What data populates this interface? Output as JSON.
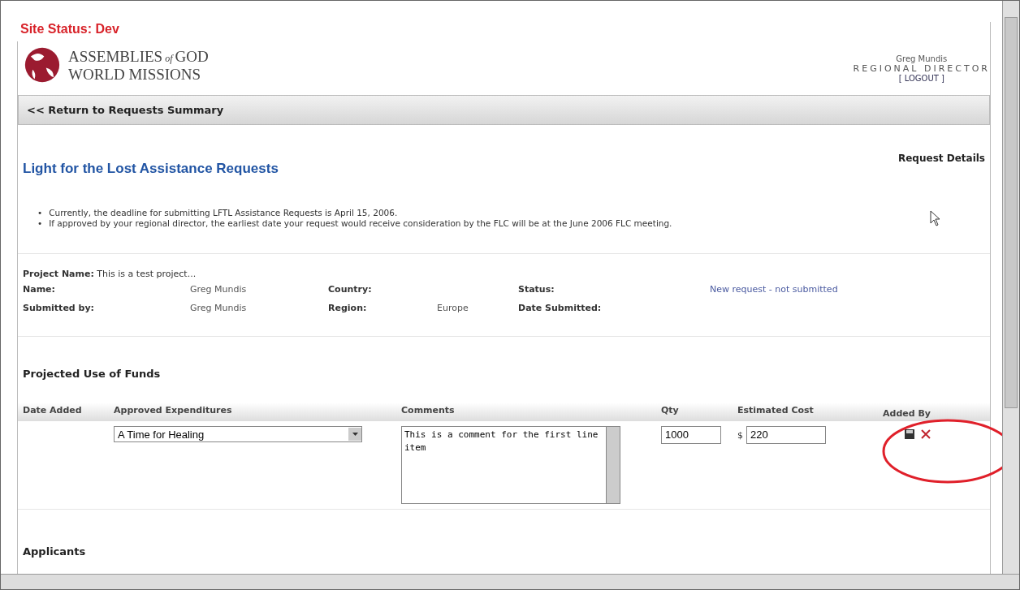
{
  "site_status": "Site Status: Dev",
  "logo": {
    "line1_a": "ASSEMBLIES",
    "line1_of": "of",
    "line1_b": "GOD",
    "line2": "WORLD MISSIONS"
  },
  "user": {
    "name": "Greg Mundis",
    "role": "REGIONAL DIRECTOR",
    "logout": "[ LOGOUT ]"
  },
  "nav": {
    "back_link": "<< Return to Requests Summary"
  },
  "page": {
    "title": "Light for the Lost Assistance Requests",
    "section_label": "Request Details"
  },
  "notes": [
    {
      "bullet": "•",
      "text": "Currently, the deadline for submitting LFTL Assistance Requests is April 15, 2006."
    },
    {
      "bullet": "•",
      "text": "If approved by your regional director, the earliest date your request would receive consideration by the FLC will be at the June 2006 FLC meeting."
    }
  ],
  "project": {
    "label": "Project Name:",
    "value": "This is a test project...",
    "fields": [
      {
        "label": "Name:",
        "value": "Greg Mundis",
        "kind": "plain"
      },
      {
        "label": "Country:"
      },
      {
        "label": "Status:",
        "value": "New request - not submitted",
        "kind": "link"
      },
      {
        "label": "Submitted by:",
        "value": "Greg Mundis",
        "kind": "plain"
      },
      {
        "label": "Region:",
        "value": "Europe",
        "kind": "plain"
      },
      {
        "label": "Date Submitted:"
      }
    ]
  },
  "funds": {
    "heading": "Projected Use of Funds",
    "columns": [
      "Date Added",
      "Approved Expenditures",
      "Comments",
      "Qty",
      "Estimated Cost",
      "Added By"
    ],
    "rows": [
      {
        "expenditure": "A Time for Healing",
        "comment": "This is a comment for the first line item",
        "qty": "1000",
        "currency": "$",
        "cost": "220"
      }
    ]
  },
  "applicants_heading": "Applicants"
}
